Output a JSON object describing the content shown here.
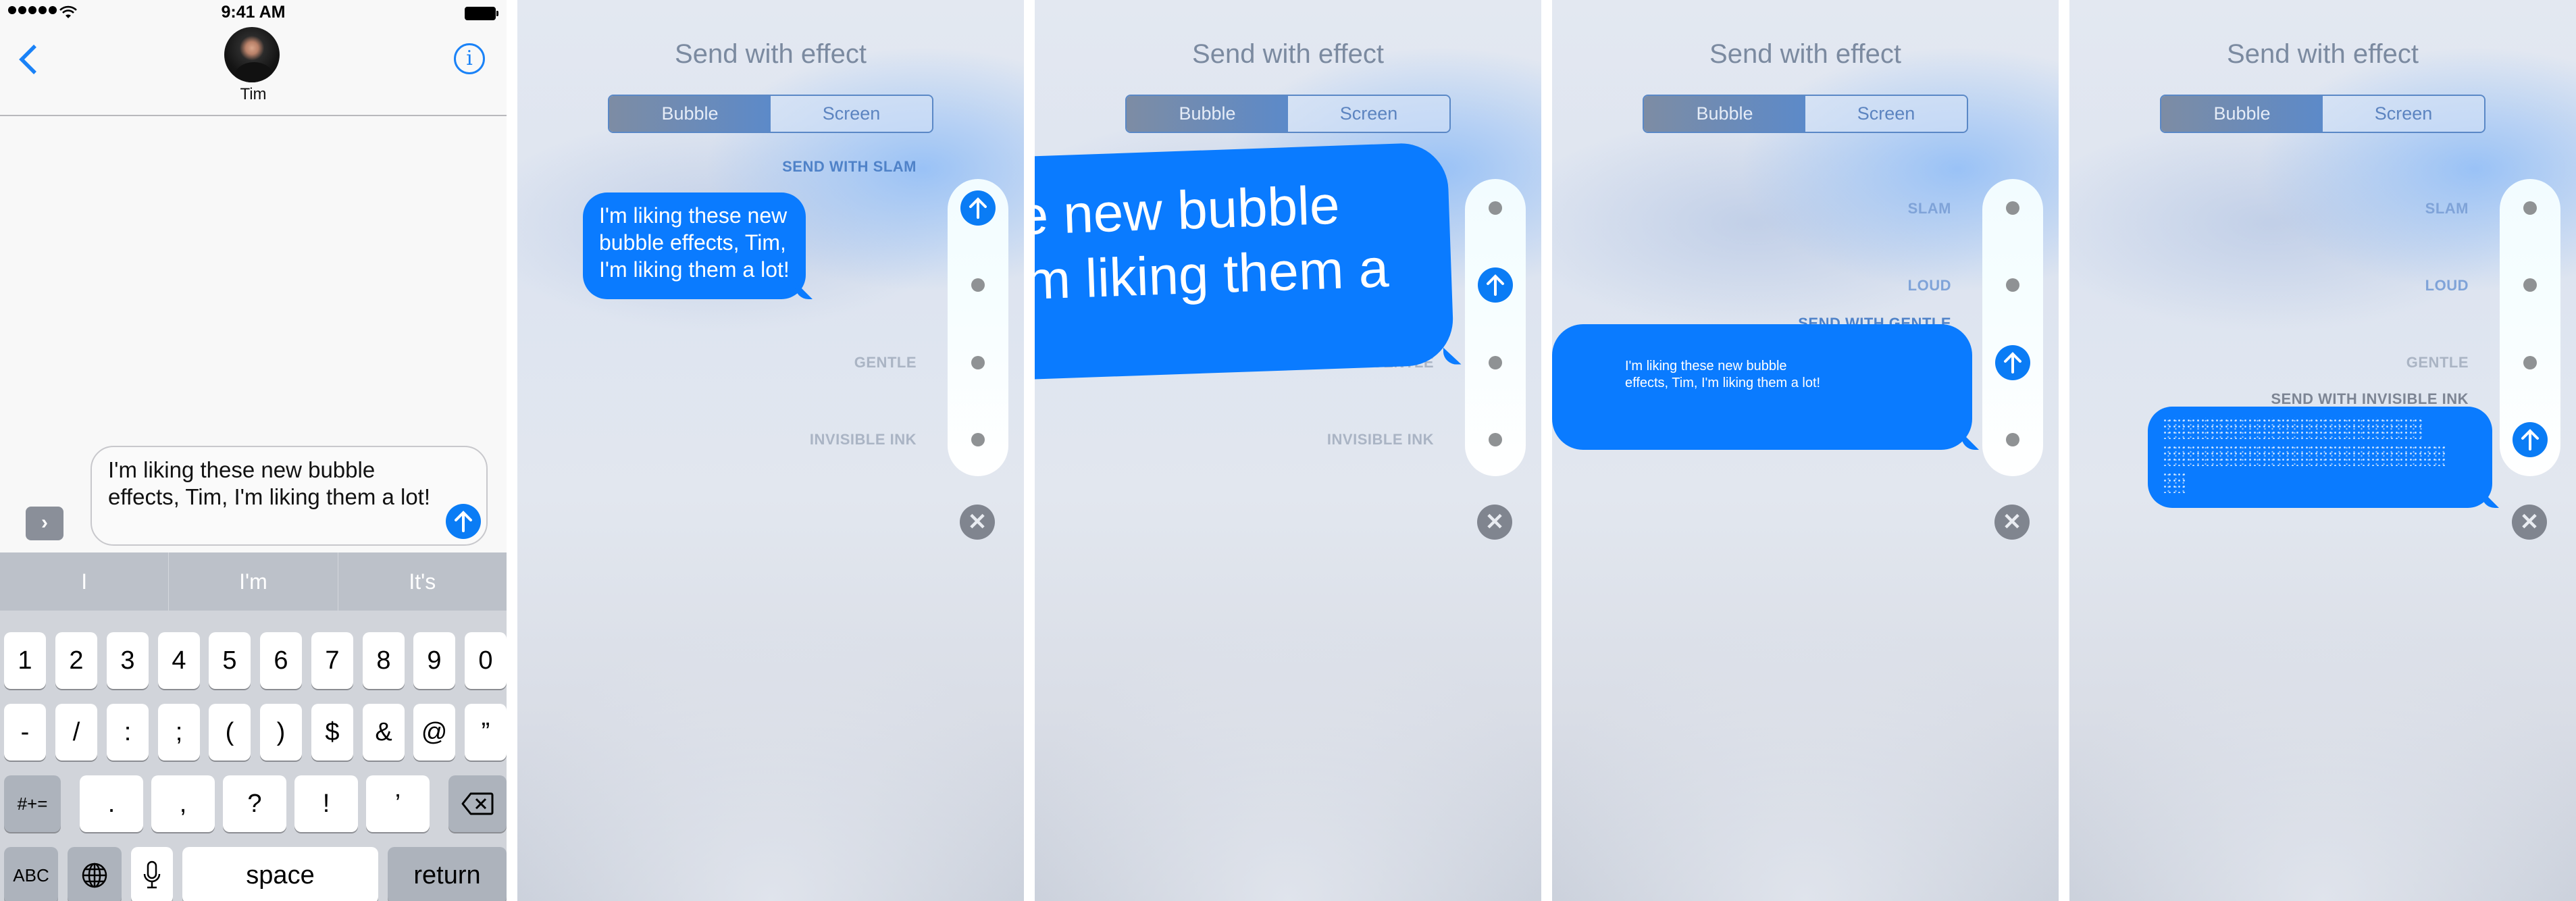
{
  "message_text": "I'm liking these new bubble effects, Tim, I'm liking them a lot!",
  "colors": {
    "accent_blue": "#0a7bff",
    "send_blue": "#0a7cf5",
    "effect_label_gray": "#aab4c4",
    "close_gray": "#80858f"
  },
  "compose_screen": {
    "status_bar": {
      "time": "9:41 AM",
      "signal_icon": "signal-dots-icon",
      "wifi_icon": "wifi-icon",
      "battery_icon": "battery-icon"
    },
    "nav": {
      "back_icon": "chevron-left-icon",
      "contact_name": "Tim",
      "info_icon": "info-icon"
    },
    "apps_button": "›",
    "compose_field": {
      "value": "I'm liking these new bubble effects, Tim, I'm liking them a lot!",
      "send_icon": "arrow-up-icon"
    },
    "predictive": [
      "I",
      "I'm",
      "It's"
    ],
    "keyboard": {
      "row1": [
        "1",
        "2",
        "3",
        "4",
        "5",
        "6",
        "7",
        "8",
        "9",
        "0"
      ],
      "row2": [
        "-",
        "/",
        ":",
        ";",
        "(",
        ")",
        "$",
        "&",
        "@",
        "”"
      ],
      "row3": [
        "#+=",
        ".",
        ",",
        "?",
        "!",
        "’"
      ],
      "delete_icon": "backspace-icon",
      "row4": {
        "abc": "ABC",
        "globe_icon": "globe-icon",
        "mic_icon": "microphone-icon",
        "space": "space",
        "return": "return"
      }
    }
  },
  "effect_picker": {
    "title": "Send with effect",
    "tabs": [
      {
        "label": "Bubble",
        "selected": true
      },
      {
        "label": "Screen",
        "selected": false
      }
    ],
    "effects": [
      "SLAM",
      "LOUD",
      "GENTLE",
      "INVISIBLE INK"
    ],
    "close_label": "✕"
  },
  "effect_screens": [
    {
      "selected_effect": "SLAM",
      "selected_label": "SEND WITH SLAM",
      "visible_labels": [
        "GENTLE",
        "INVISIBLE INK"
      ]
    },
    {
      "selected_effect": "LOUD",
      "selected_label": "",
      "visible_labels": [
        "GENTLE",
        "INVISIBLE INK"
      ]
    },
    {
      "selected_effect": "GENTLE",
      "selected_label": "SEND WITH GENTLE",
      "visible_labels": [
        "SLAM",
        "LOUD"
      ]
    },
    {
      "selected_effect": "INVISIBLE INK",
      "selected_label": "SEND WITH INVISIBLE INK",
      "visible_labels": [
        "SLAM",
        "LOUD",
        "GENTLE"
      ]
    }
  ]
}
